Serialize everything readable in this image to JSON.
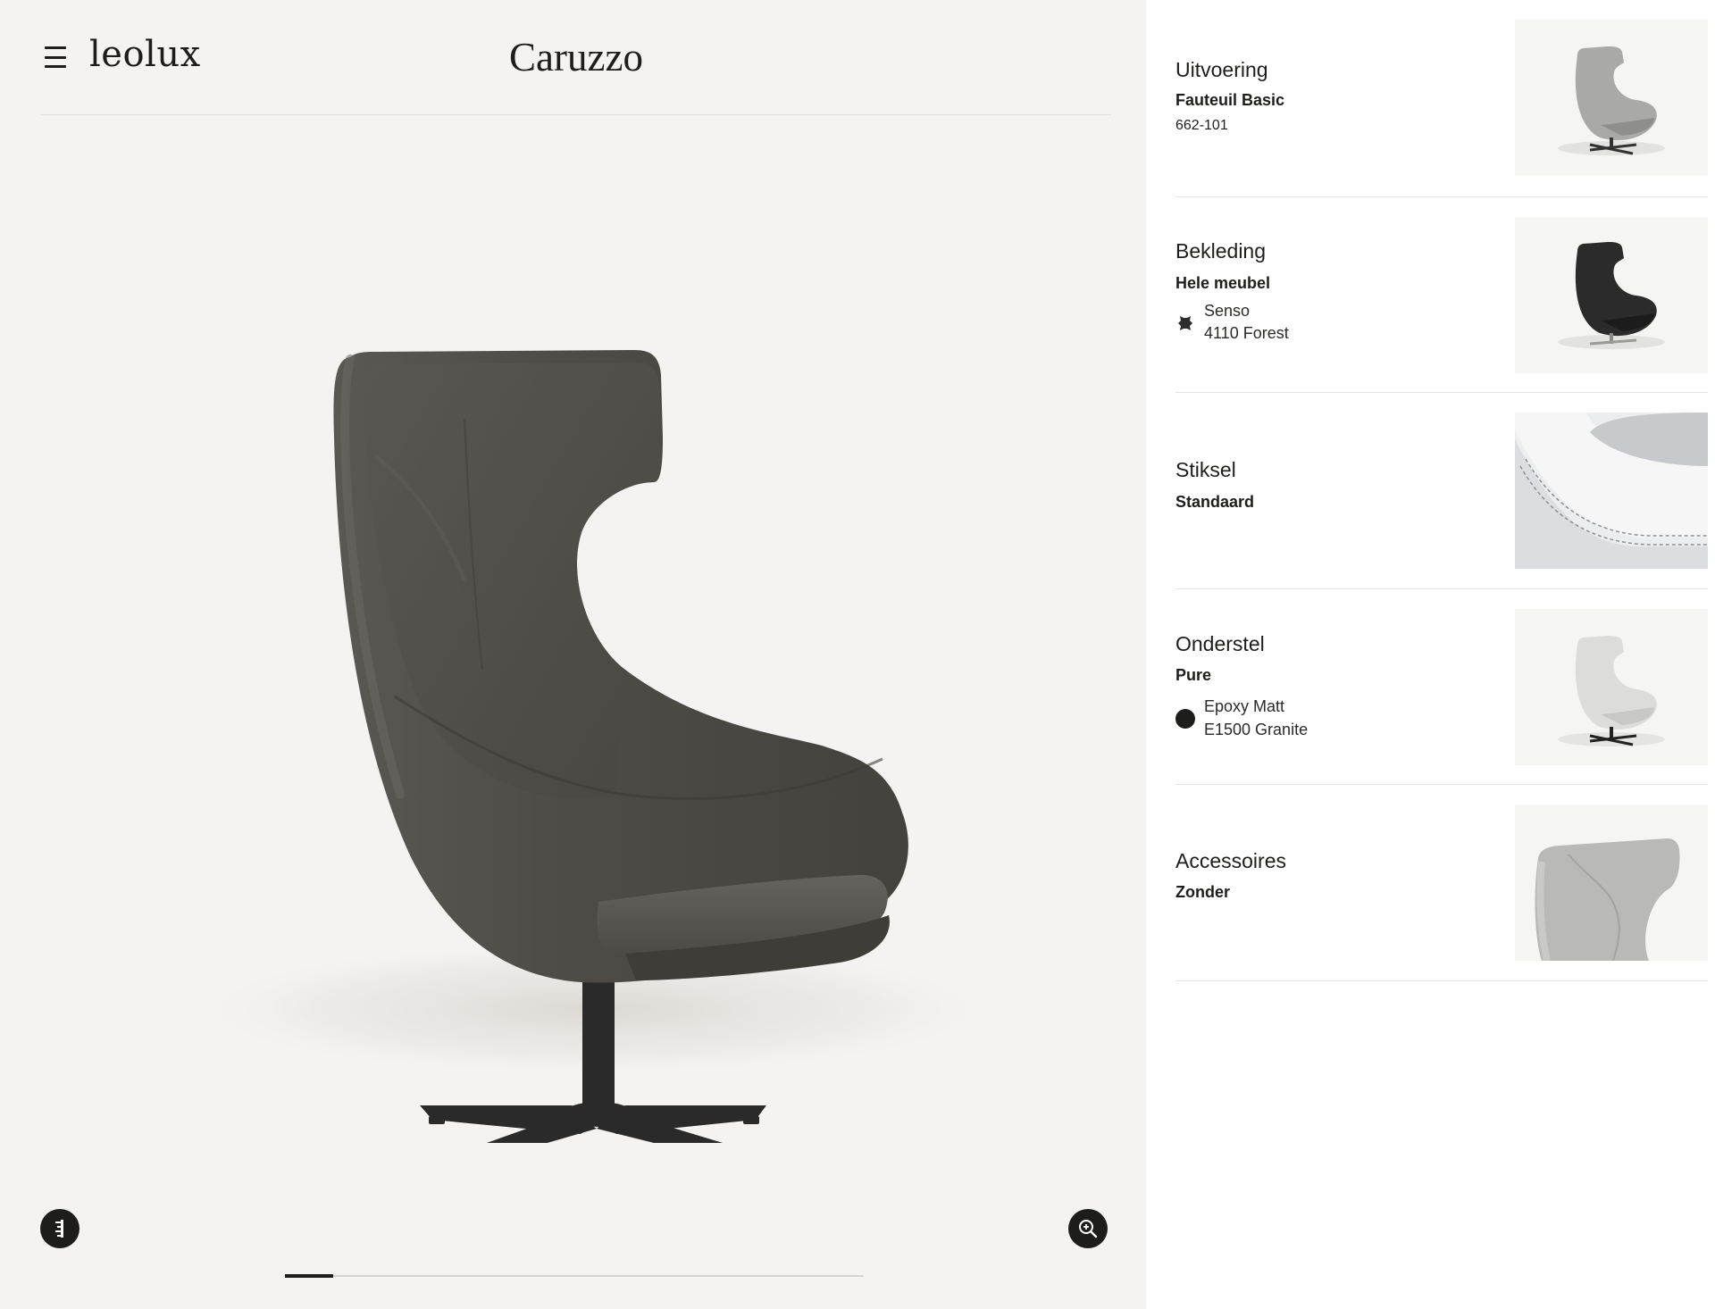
{
  "header": {
    "logo": "leolux",
    "title": "Caruzzo"
  },
  "viewer": {
    "progress_fraction": 0.083,
    "icons": {
      "menu": "hamburger-menu-icon",
      "dimensions": "ruler-icon",
      "zoom": "zoom-in-icon"
    }
  },
  "options": [
    {
      "title": "Uitvoering",
      "subtitle": "Fauteuil Basic",
      "line": "662-101"
    },
    {
      "title": "Bekleding",
      "subtitle": "Hele meubel",
      "detail_1": "Senso",
      "detail_2": "4110 Forest",
      "swatch_icon": "leather-hide-icon"
    },
    {
      "title": "Stiksel",
      "subtitle": "Standaard"
    },
    {
      "title": "Onderstel",
      "subtitle": "Pure",
      "detail_1": "Epoxy Matt",
      "detail_2": "E1500 Granite",
      "swatch_color": "#1d1d1b"
    },
    {
      "title": "Accessoires",
      "subtitle": "Zonder"
    }
  ],
  "colors": {
    "viewer_bg": "#f4f3f1",
    "chair_leather": "#514d49",
    "base": "#2a2a2a",
    "ink": "#1d1d1b"
  }
}
